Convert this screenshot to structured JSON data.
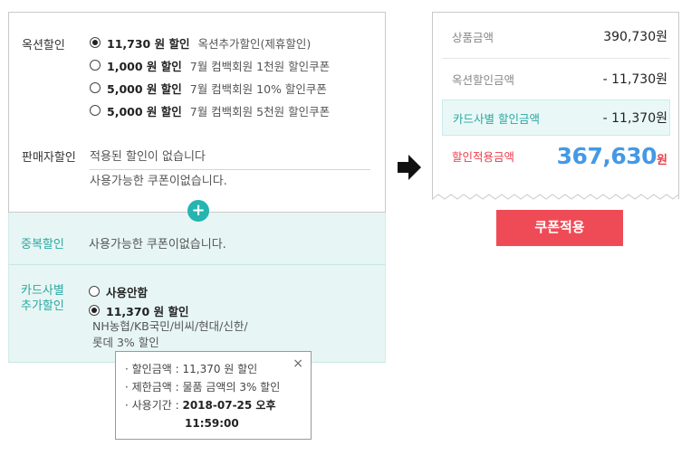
{
  "auction_discount": {
    "label": "옥션할인",
    "options": [
      {
        "amount": "11,730 원 할인",
        "desc": "옥션추가할인(제휴할인)",
        "selected": true
      },
      {
        "amount": "1,000 원 할인",
        "desc": "7월 컴백회원 1천원 할인쿠폰",
        "selected": false
      },
      {
        "amount": "5,000 원 할인",
        "desc": "7월 컴백회원 10% 할인쿠폰",
        "selected": false
      },
      {
        "amount": "5,000 원 할인",
        "desc": "7월 컴백회원 5천원 할인쿠폰",
        "selected": false
      }
    ]
  },
  "seller_discount": {
    "label": "판매자할인",
    "value": "적용된 할인이 없습니다",
    "extra": "사용가능한 쿠폰이없습니다."
  },
  "plus_symbol": "+",
  "duplicate_discount": {
    "label": "중복할인",
    "value": "사용가능한 쿠폰이없습니다."
  },
  "card_discount": {
    "label_line1": "카드사별",
    "label_line2": "추가할인",
    "options": [
      {
        "label": "사용안함",
        "selected": false
      },
      {
        "label": "11,370 원 할인",
        "selected": true
      }
    ],
    "desc_line1": "NH농협/KB국민/비씨/현대/신한/",
    "desc_line2": "롯데 3% 할인"
  },
  "tooltip": {
    "close": "×",
    "row1_label": "· 할인금액 :",
    "row1_value": "11,370 원 할인",
    "row2_label": "· 제한금액 :",
    "row2_value": "물품 금액의 3% 할인",
    "row3_label": "· 사용기간 :",
    "row3_value": "2018-07-25 오후",
    "row3_value2": "11:59:00"
  },
  "summary": {
    "product_label": "상품금액",
    "product_value": "390,730원",
    "auction_label": "옥션할인금액",
    "auction_value": "- 11,730원",
    "card_label": "카드사별 할인금액",
    "card_value": "- 11,370원",
    "final_label": "할인적용금액",
    "final_amount": "367,630",
    "final_unit": "원"
  },
  "apply_button": "쿠폰적용",
  "colors": {
    "teal": "#25b4b1",
    "red": "#ef4b57",
    "blue": "#4499e6",
    "panel_bg": "#e7f6f4"
  },
  "icons": [
    "radio-selected-icon",
    "radio-empty-icon",
    "plus-icon",
    "arrow-right-icon",
    "close-icon"
  ]
}
